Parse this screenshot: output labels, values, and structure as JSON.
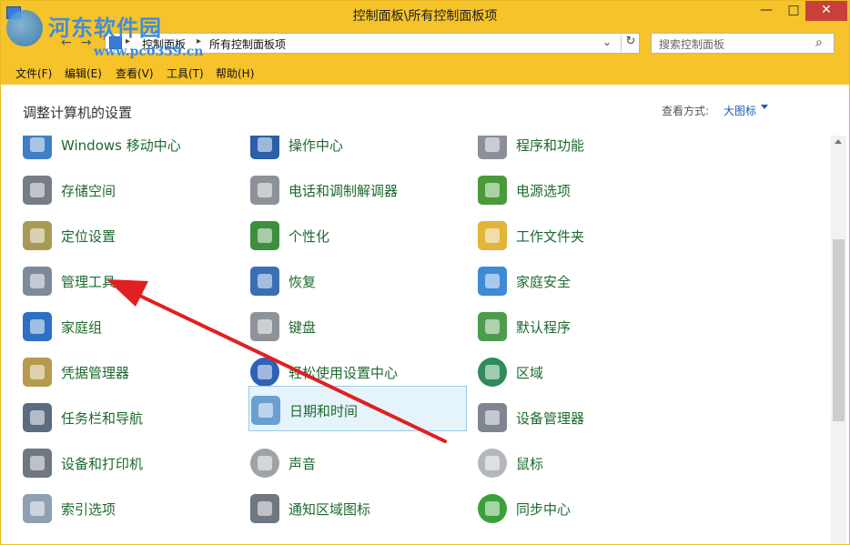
{
  "window": {
    "title": "控制面板\\所有控制面板项",
    "minimize_glyph": "—",
    "maximize_glyph": "□",
    "close_glyph": "✕"
  },
  "watermark": {
    "name": "河东软件园",
    "url": "www.pc0359.cn"
  },
  "nav": {
    "back_glyph": "←",
    "forward_glyph": "→",
    "up_glyph": "↑"
  },
  "address": {
    "crumbs": [
      "控制面板",
      "所有控制面板项"
    ],
    "sep_glyph": "▸",
    "dropdown_glyph": "⌄",
    "refresh_glyph": "↻"
  },
  "search": {
    "placeholder": "搜索控制面板",
    "icon_glyph": "⌕"
  },
  "menu": [
    "文件(F)",
    "编辑(E)",
    "查看(V)",
    "工具(T)",
    "帮助(H)"
  ],
  "header": {
    "title": "调整计算机的设置",
    "view_label": "查看方式:",
    "view_value": "大图标"
  },
  "items": [
    [
      "Windows 移动中心",
      "操作中心",
      "程序和功能"
    ],
    [
      "存储空间",
      "电话和调制解调器",
      "电源选项"
    ],
    [
      "定位设置",
      "个性化",
      "工作文件夹"
    ],
    [
      "管理工具",
      "恢复",
      "家庭安全"
    ],
    [
      "家庭组",
      "键盘",
      "默认程序"
    ],
    [
      "凭据管理器",
      "轻松使用设置中心",
      "区域"
    ],
    [
      "任务栏和导航",
      "日期和时间",
      "设备管理器"
    ],
    [
      "设备和打印机",
      "声音",
      "鼠标"
    ],
    [
      "索引选项",
      "通知区域图标",
      "同步中心"
    ]
  ],
  "selected_item": "日期和时间",
  "annotation": {
    "arrow_color": "#e02020"
  }
}
